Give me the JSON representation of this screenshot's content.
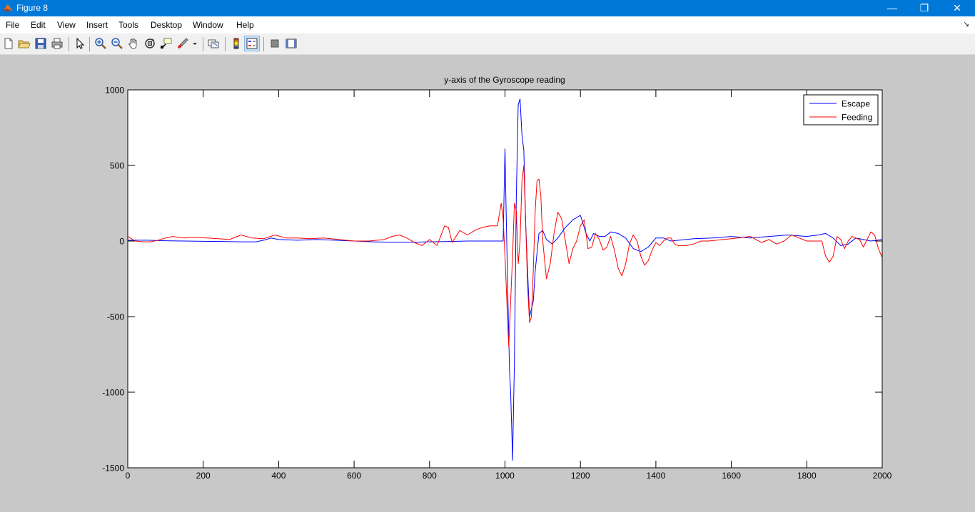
{
  "window": {
    "title": "Figure 8",
    "controls": [
      "minimize",
      "restore",
      "close"
    ],
    "minimize_glyph": "—",
    "restore_glyph": "❐",
    "close_glyph": "✕"
  },
  "menu": {
    "items": [
      "File",
      "Edit",
      "View",
      "Insert",
      "Tools",
      "Desktop",
      "Window",
      "Help"
    ],
    "overflow_glyph": "↘"
  },
  "toolbar": {
    "buttons": [
      "new-figure",
      "open-file",
      "save-figure",
      "print-figure",
      "edit-plot",
      "zoom-in",
      "zoom-out",
      "pan",
      "rotate-3d",
      "data-cursor",
      "brush",
      "link-plot",
      "colorbar",
      "legend",
      "hide-plot-tools",
      "show-plot-tools"
    ]
  },
  "colors": {
    "escape": "#0000ff",
    "feeding": "#ff0000",
    "titlebar": "#0078d7"
  },
  "chart_data": {
    "type": "line",
    "title": "y-axis of the Gyroscope reading",
    "xlabel": "",
    "ylabel": "",
    "xlim": [
      0,
      2000
    ],
    "ylim": [
      -1500,
      1000
    ],
    "xticks": [
      0,
      200,
      400,
      600,
      800,
      1000,
      1200,
      1400,
      1600,
      1800,
      2000
    ],
    "yticks": [
      -1500,
      -1000,
      -500,
      0,
      500,
      1000
    ],
    "grid": false,
    "legend": {
      "position": "top-right",
      "entries": [
        "Escape",
        "Feeding"
      ]
    },
    "series": [
      {
        "name": "Escape",
        "color": "#0000ff",
        "x": [
          0,
          50,
          100,
          150,
          200,
          250,
          300,
          340,
          360,
          380,
          400,
          450,
          500,
          550,
          600,
          650,
          700,
          750,
          800,
          850,
          900,
          950,
          995,
          1000,
          1003,
          1008,
          1012,
          1015,
          1018,
          1020,
          1022,
          1025,
          1030,
          1035,
          1040,
          1045,
          1050,
          1055,
          1060,
          1065,
          1070,
          1075,
          1080,
          1090,
          1100,
          1110,
          1125,
          1140,
          1160,
          1180,
          1200,
          1215,
          1225,
          1235,
          1250,
          1265,
          1280,
          1300,
          1320,
          1340,
          1360,
          1380,
          1400,
          1420,
          1440,
          1460,
          1480,
          1500,
          1550,
          1600,
          1650,
          1700,
          1750,
          1800,
          1830,
          1850,
          1870,
          1890,
          1910,
          1930,
          1950,
          1970,
          2000
        ],
        "y": [
          5,
          5,
          2,
          0,
          -2,
          -3,
          -5,
          -5,
          5,
          20,
          10,
          5,
          10,
          5,
          0,
          -5,
          -8,
          -8,
          -5,
          -3,
          0,
          0,
          0,
          610,
          200,
          -400,
          -850,
          -1000,
          -1250,
          -1450,
          -1200,
          -800,
          300,
          900,
          940,
          700,
          600,
          100,
          -200,
          -500,
          -450,
          -400,
          -200,
          50,
          70,
          10,
          -20,
          20,
          90,
          140,
          170,
          50,
          0,
          50,
          30,
          30,
          60,
          50,
          20,
          -50,
          -70,
          -40,
          20,
          20,
          0,
          5,
          10,
          15,
          20,
          30,
          20,
          30,
          40,
          30,
          40,
          50,
          20,
          -30,
          -20,
          20,
          10,
          0,
          10
        ]
      },
      {
        "name": "Feeding",
        "color": "#ff0000",
        "x": [
          0,
          20,
          40,
          60,
          80,
          100,
          120,
          150,
          180,
          210,
          240,
          270,
          300,
          330,
          360,
          390,
          420,
          450,
          480,
          520,
          560,
          600,
          640,
          680,
          700,
          720,
          740,
          760,
          780,
          800,
          820,
          840,
          850,
          860,
          880,
          900,
          920,
          940,
          960,
          980,
          990,
          995,
          1000,
          1005,
          1010,
          1015,
          1020,
          1025,
          1030,
          1035,
          1040,
          1045,
          1050,
          1055,
          1060,
          1065,
          1070,
          1075,
          1080,
          1085,
          1090,
          1095,
          1100,
          1110,
          1120,
          1130,
          1140,
          1150,
          1160,
          1170,
          1180,
          1190,
          1200,
          1210,
          1220,
          1230,
          1240,
          1250,
          1260,
          1270,
          1280,
          1290,
          1300,
          1310,
          1320,
          1330,
          1340,
          1350,
          1360,
          1370,
          1380,
          1390,
          1400,
          1410,
          1420,
          1430,
          1440,
          1450,
          1460,
          1480,
          1500,
          1520,
          1540,
          1560,
          1600,
          1650,
          1680,
          1700,
          1720,
          1740,
          1760,
          1780,
          1800,
          1820,
          1840,
          1850,
          1860,
          1870,
          1880,
          1890,
          1900,
          1910,
          1920,
          1930,
          1940,
          1950,
          1960,
          1970,
          1980,
          1990,
          2000
        ],
        "y": [
          30,
          0,
          -5,
          -5,
          5,
          20,
          30,
          20,
          25,
          20,
          15,
          10,
          40,
          20,
          15,
          40,
          20,
          20,
          15,
          20,
          10,
          0,
          0,
          10,
          30,
          40,
          20,
          -10,
          -30,
          10,
          -30,
          100,
          90,
          -10,
          70,
          40,
          70,
          90,
          100,
          100,
          250,
          150,
          -100,
          -400,
          -700,
          -400,
          -100,
          250,
          200,
          -150,
          0,
          400,
          500,
          100,
          -300,
          -540,
          -500,
          -200,
          200,
          400,
          410,
          300,
          0,
          -250,
          -150,
          50,
          190,
          150,
          0,
          -150,
          -50,
          0,
          100,
          140,
          -50,
          -40,
          50,
          10,
          -60,
          -40,
          30,
          -60,
          -180,
          -230,
          -150,
          -20,
          40,
          0,
          -100,
          -160,
          -130,
          -60,
          -10,
          -30,
          0,
          20,
          20,
          -20,
          -30,
          -30,
          -20,
          0,
          0,
          5,
          15,
          30,
          -10,
          10,
          -20,
          0,
          40,
          20,
          0,
          0,
          0,
          -100,
          -140,
          -100,
          30,
          10,
          -50,
          0,
          30,
          20,
          10,
          -40,
          10,
          60,
          40,
          -50,
          -110
        ]
      }
    ]
  }
}
